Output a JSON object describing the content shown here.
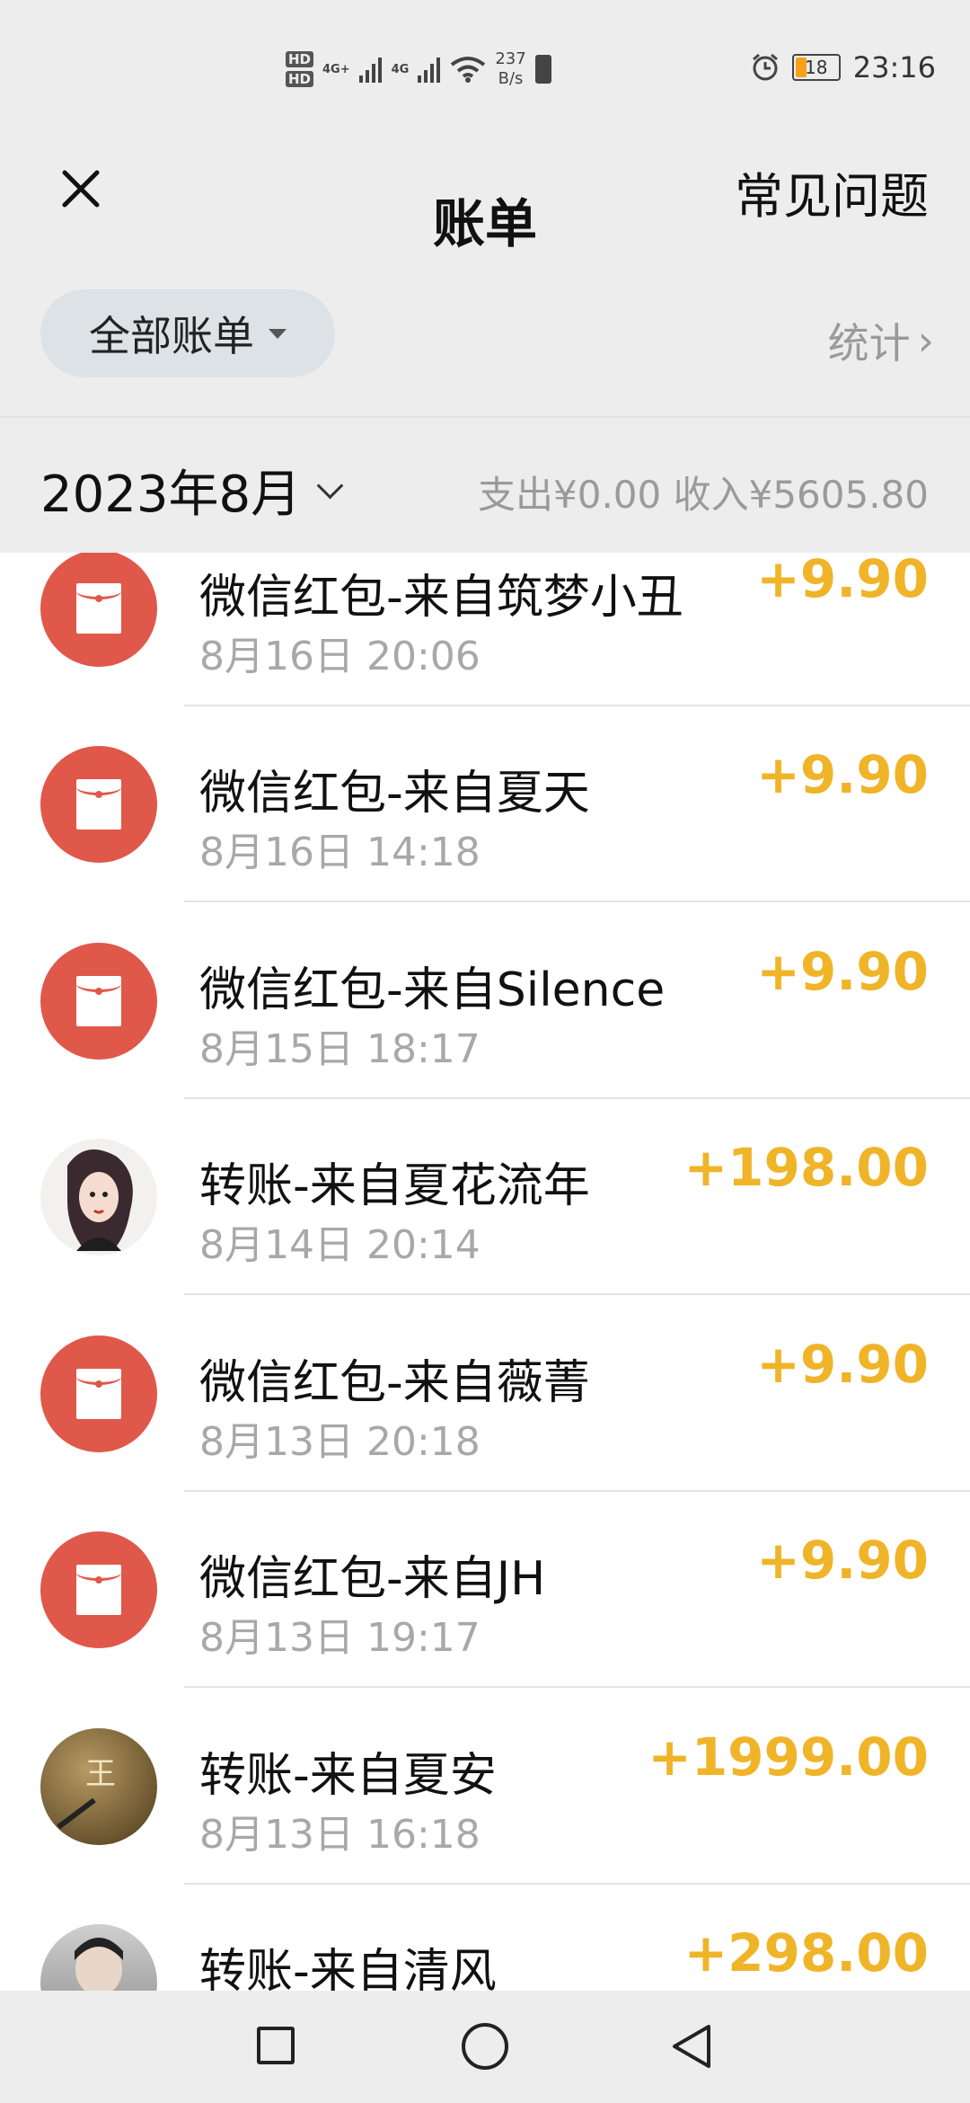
{
  "status_bar": {
    "hd1": "HD",
    "hd2": "HD",
    "net1": "4G+",
    "net2": "4G",
    "speed_value": "237",
    "speed_unit": "B/s",
    "battery": "18",
    "time": "23:16"
  },
  "header": {
    "title": "账单",
    "faq": "常见问题"
  },
  "filter": {
    "label": "全部账单",
    "stats": "统计",
    "stats_chevron": "›"
  },
  "month": {
    "label": "2023年8月",
    "summary": "支出¥0.00 收入¥5605.80"
  },
  "transactions": [
    {
      "title": "微信红包-来自筑梦小丑",
      "time": "8月16日 20:06",
      "amount": "+9.90",
      "avatar": "red-packet-icon"
    },
    {
      "title": "微信红包-来自夏天",
      "time": "8月16日 14:18",
      "amount": "+9.90",
      "avatar": "red-packet-icon"
    },
    {
      "title": "微信红包-来自Silence",
      "time": "8月15日 18:17",
      "amount": "+9.90",
      "avatar": "red-packet-icon"
    },
    {
      "title": "转账-来自夏花流年",
      "time": "8月14日 20:14",
      "amount": "+198.00",
      "avatar": "user-avatar"
    },
    {
      "title": "微信红包-来自薇菁",
      "time": "8月13日 20:18",
      "amount": "+9.90",
      "avatar": "red-packet-icon"
    },
    {
      "title": "微信红包-来自JH",
      "time": "8月13日 19:17",
      "amount": "+9.90",
      "avatar": "red-packet-icon"
    },
    {
      "title": "转账-来自夏安",
      "time": "8月13日 16:18",
      "amount": "+1999.00",
      "avatar": "user-avatar"
    },
    {
      "title": "转账-来自清风",
      "time": "",
      "amount": "+298.00",
      "avatar": "user-avatar"
    }
  ],
  "avatar_text": {
    "seal": "王"
  },
  "colors": {
    "amount": "#f0b429",
    "red_packet": "#e0584a",
    "header_bg": "#ededed"
  }
}
